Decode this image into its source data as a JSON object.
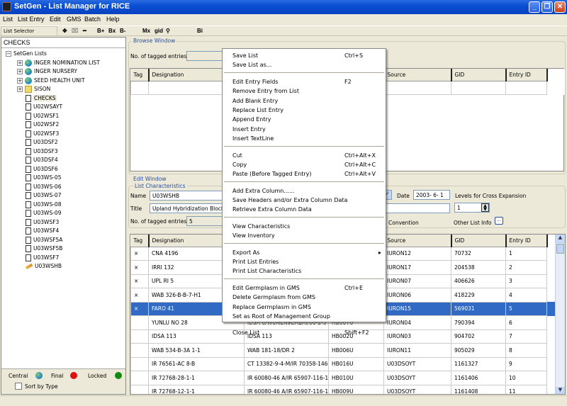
{
  "window": {
    "title": "SetGen - List Manager for RICE",
    "minimize": "_",
    "restore": "❐",
    "close": "✕"
  },
  "menubar": [
    "List",
    "List Entry",
    "Edit",
    "GMS",
    "Batch",
    "Help"
  ],
  "toolbar": {
    "list_selector": "List Selector",
    "buttons": [
      "✥",
      "⌧",
      "━",
      "B+",
      "Bx",
      "B-",
      "Mx",
      "gid",
      "Bi"
    ],
    "binoculars": "⚲"
  },
  "left": {
    "current_list": "CHECKS",
    "root": "SetGen Lists",
    "folders": [
      {
        "label": "INGER NOMINATION LIST",
        "icon": "globe-folder"
      },
      {
        "label": "INGER NURSERY",
        "icon": "globe-folder"
      },
      {
        "label": "SEED HEALTH UNIT",
        "icon": "globe-folder"
      },
      {
        "label": "SISON",
        "icon": "folder"
      }
    ],
    "lists": [
      "CHECKS",
      "U02WSAYT",
      "U02WSF1",
      "U02WSF2",
      "U02WSF3",
      "U03DSF2",
      "U03DSF3",
      "U03DSF4",
      "U03DSF6",
      "U03WS-05",
      "U03WS-06",
      "U03WS-07",
      "U03WS-08",
      "U03WS-09",
      "U03WSF3",
      "U03WSF4",
      "U03WSF5A",
      "U03WSF5B",
      "U03WSF7",
      "U03WSHB"
    ],
    "legend": {
      "central": "Central",
      "final": "Final",
      "locked": "Locked",
      "sort": "Sort by Type"
    }
  },
  "browse": {
    "title": "Browse Window",
    "tagged_label": "No. of tagged entries",
    "tagged_value": "",
    "columns": [
      "Tag",
      "Designation",
      "",
      "",
      "Source",
      "GID",
      "Entry ID"
    ]
  },
  "edit": {
    "title": "Edit Window",
    "char_title": "List Characteristics",
    "name_label": "Name",
    "name_value": "U03WSHB",
    "title_label": "Title",
    "title_value": "Upland Hybridization Block",
    "tagged_label": "No. of tagged entries",
    "tagged_value": "5",
    "date_label": "Date",
    "date_value": "2003- 6- 1",
    "levels_label": "Levels for Cross Expansion",
    "levels_value": "1",
    "convention_label": "Convention",
    "other_info_label": "Other List Info",
    "other_info_btn": "...",
    "columns": [
      "Tag",
      "Designation",
      "",
      "",
      "Source",
      "GID",
      "Entry ID"
    ],
    "rows": [
      [
        "×",
        "CNA 4196",
        "",
        "",
        "IURON12",
        "70732",
        "1"
      ],
      [
        "×",
        "IRRI 132",
        "",
        "",
        "IURON17",
        "204538",
        "2"
      ],
      [
        "×",
        "UPL RI 5",
        "",
        "",
        "IURON07",
        "406626",
        "3"
      ],
      [
        "×",
        "WAB 326-B-B-7-H1",
        "",
        "",
        "IURON06",
        "418229",
        "4"
      ],
      [
        "×",
        "FARO 41",
        "",
        "",
        "IURON15",
        "569031",
        "5"
      ],
      [
        "",
        "YUNLU NO 28",
        "IDSA 6/WUNEN9DABAI/00-2-3",
        "HB007U",
        "IURON04",
        "790394",
        "6"
      ],
      [
        "",
        "IDSA 113",
        "IDSA 113",
        "HB002U",
        "IURON03",
        "904702",
        "7"
      ],
      [
        "",
        "WAB 534-B-3A 1-1",
        "WAB 181-18/DR 2",
        "HB006U",
        "IURON11",
        "905029",
        "8"
      ],
      [
        "",
        "IR 76561-AC 8-B",
        "CT 13382-9-4-M/IR 70358-146-",
        "HB016U",
        "U03DSOYT",
        "1161327",
        "9"
      ],
      [
        "",
        "IR 72768-28-1-1",
        "IR 60080-46 A/IR 65907-116-1-",
        "HB010U",
        "U03DSOYT",
        "1161406",
        "10"
      ],
      [
        "",
        "IR 72768-12-1-1",
        "IR 60080-46 A/IR 65907-116-1-",
        "HB009U",
        "U03DSOYT",
        "1161408",
        "11"
      ]
    ],
    "selected_row": 5
  },
  "context_menu": [
    [
      {
        "label": "Save List",
        "shortcut": "Ctrl+S"
      },
      {
        "label": "Save List as...",
        "shortcut": ""
      }
    ],
    [
      {
        "label": "Edit Entry Fields",
        "shortcut": "F2"
      },
      {
        "label": "Remove Entry from List",
        "shortcut": ""
      },
      {
        "label": "Add Blank Entry",
        "shortcut": ""
      },
      {
        "label": "Replace List Entry",
        "shortcut": ""
      },
      {
        "label": "Append Entry",
        "shortcut": ""
      },
      {
        "label": "Insert Entry",
        "shortcut": ""
      },
      {
        "label": "Insert TextLine",
        "shortcut": ""
      }
    ],
    [
      {
        "label": "Cut",
        "shortcut": "Ctrl+Alt+X"
      },
      {
        "label": "Copy",
        "shortcut": "Ctrl+Alt+C"
      },
      {
        "label": "Paste (Before Tagged Entry)",
        "shortcut": "Ctrl+Alt+V"
      }
    ],
    [
      {
        "label": "Add Extra Column......",
        "shortcut": ""
      },
      {
        "label": "Save Headers and/or Extra Column Data",
        "shortcut": ""
      },
      {
        "label": "Retrieve Extra Column Data",
        "shortcut": ""
      }
    ],
    [
      {
        "label": "View Characteristics",
        "shortcut": ""
      },
      {
        "label": "View Inventory",
        "shortcut": ""
      }
    ],
    [
      {
        "label": "Export As",
        "shortcut": "▸"
      },
      {
        "label": "Print List Entries",
        "shortcut": ""
      },
      {
        "label": "Print List Characteristics",
        "shortcut": ""
      }
    ],
    [
      {
        "label": "Edit Germplasm in GMS",
        "shortcut": "Ctrl+E"
      },
      {
        "label": "Delete Germplasm from GMS",
        "shortcut": ""
      },
      {
        "label": "Replace Germplasm in GMS",
        "shortcut": ""
      },
      {
        "label": "Set as Root of Management Group",
        "shortcut": ""
      }
    ],
    [
      {
        "label": "Close List",
        "shortcut": "Shift+F2"
      }
    ]
  ]
}
